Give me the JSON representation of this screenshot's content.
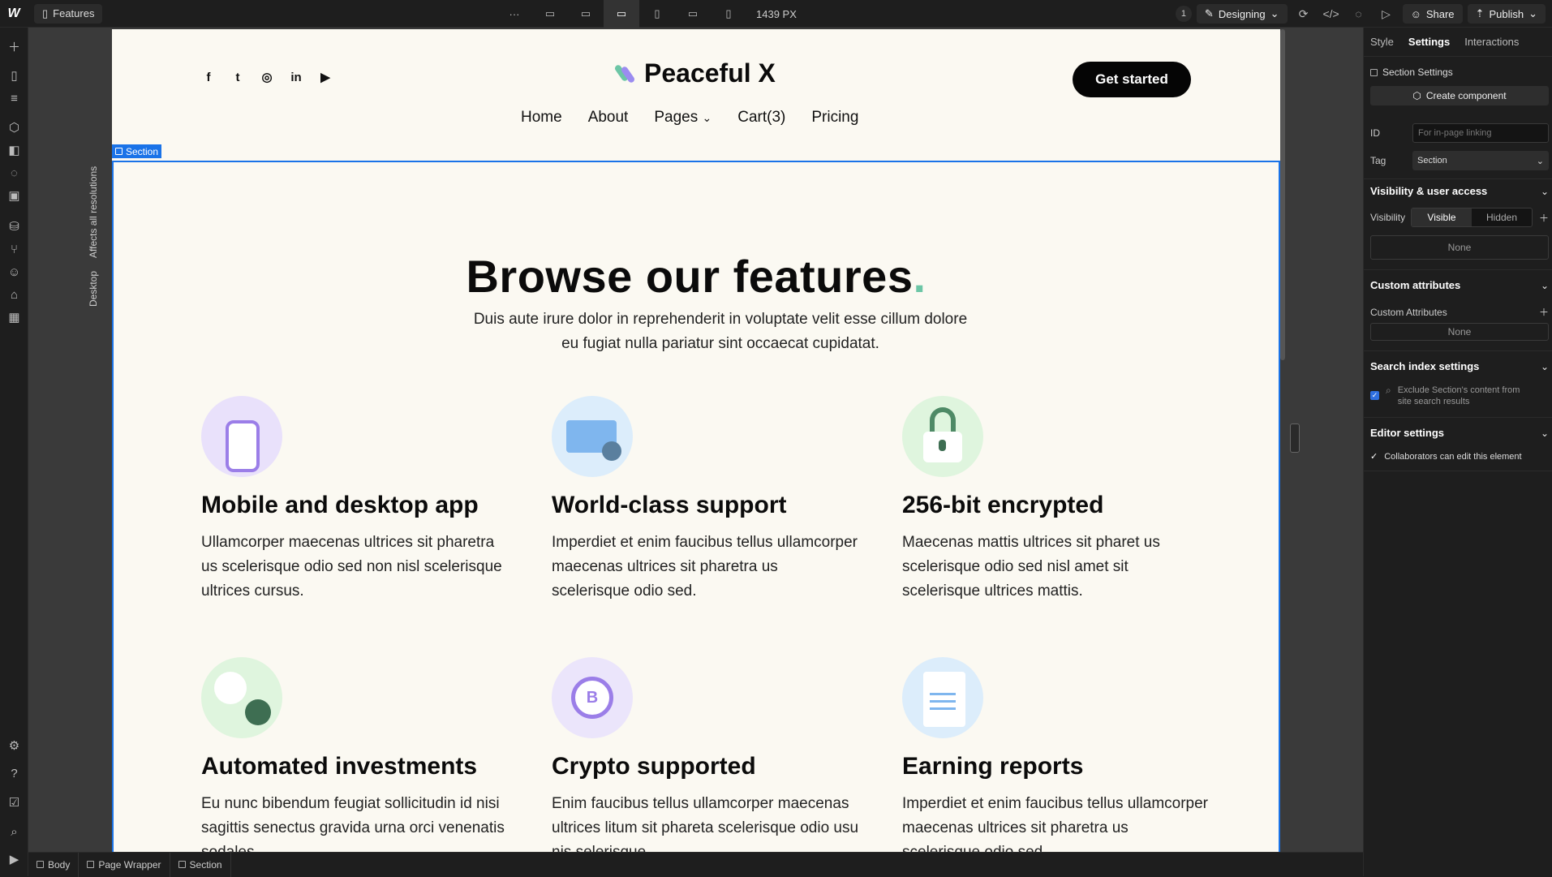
{
  "topbar": {
    "page_name": "Features",
    "more": "···",
    "px_label": "1439 PX",
    "user_count": "1",
    "mode": "Designing",
    "share": "Share",
    "publish": "Publish"
  },
  "canvas": {
    "vtab_affects": "Affects all resolutions",
    "vtab_desktop": "Desktop",
    "section_label": "Section"
  },
  "site": {
    "brand": "Peaceful X",
    "cta": "Get started",
    "nav": [
      "Home",
      "About",
      "Pages",
      "Cart(3)",
      "Pricing"
    ],
    "headline": "Browse our features",
    "headline_dot": ".",
    "intro": "Duis aute irure dolor in reprehenderit in voluptate velit esse cillum dolore eu fugiat nulla pariatur sint occaecat cupidatat.",
    "features": [
      {
        "title": "Mobile and desktop app",
        "text": "Ullamcorper maecenas ultrices sit pharetra us scelerisque odio sed non nisl scelerisque ultrices cursus.",
        "icon": "mobile-icon",
        "color": "#e9e1fb"
      },
      {
        "title": "World-class support",
        "text": "Imperdiet et enim faucibus tellus ullamcorper maecenas ultrices sit pharetra us scelerisque odio sed.",
        "icon": "envelope-icon",
        "color": "#dcedfb"
      },
      {
        "title": "256-bit encrypted",
        "text": "Maecenas mattis ultrices sit pharet us scelerisque odio sed nisl amet sit scelerisque ultrices mattis.",
        "icon": "lock-icon",
        "color": "#dff5de"
      },
      {
        "title": "Automated investments",
        "text": "Eu nunc bibendum feugiat sollicitudin id nisi sagittis senectus gravida urna orci venenatis sodales.",
        "icon": "gears-icon",
        "color": "#dff5de"
      },
      {
        "title": "Crypto supported",
        "text": "Enim faucibus tellus ullamcorper maecenas ultrices litum sit phareta  scelerisque odio usu nis selerisque.",
        "icon": "bitcoin-icon",
        "color": "#ebe5fb"
      },
      {
        "title": "Earning reports",
        "text": "Imperdiet et enim faucibus tellus ullamcorper maecenas ultrices sit pharetra us scelerisque odio sed .",
        "icon": "report-icon",
        "color": "#dcedfb"
      }
    ]
  },
  "panel": {
    "tabs": [
      "Style",
      "Settings",
      "Interactions"
    ],
    "section_settings": "Section Settings",
    "create_component": "Create component",
    "id_label": "ID",
    "id_placeholder": "For in-page linking",
    "tag_label": "Tag",
    "tag_value": "Section",
    "visibility_title": "Visibility & user access",
    "visibility_label": "Visibility",
    "visible": "Visible",
    "hidden": "Hidden",
    "none1": "None",
    "custom_attr_title": "Custom attributes",
    "custom_attr_label": "Custom Attributes",
    "none2": "None",
    "search_title": "Search index settings",
    "search_text": "Exclude Section's content from site search results",
    "editor_title": "Editor settings",
    "editor_text": "Collaborators can edit this element"
  },
  "breadcrumbs": [
    "Body",
    "Page Wrapper",
    "Section"
  ]
}
